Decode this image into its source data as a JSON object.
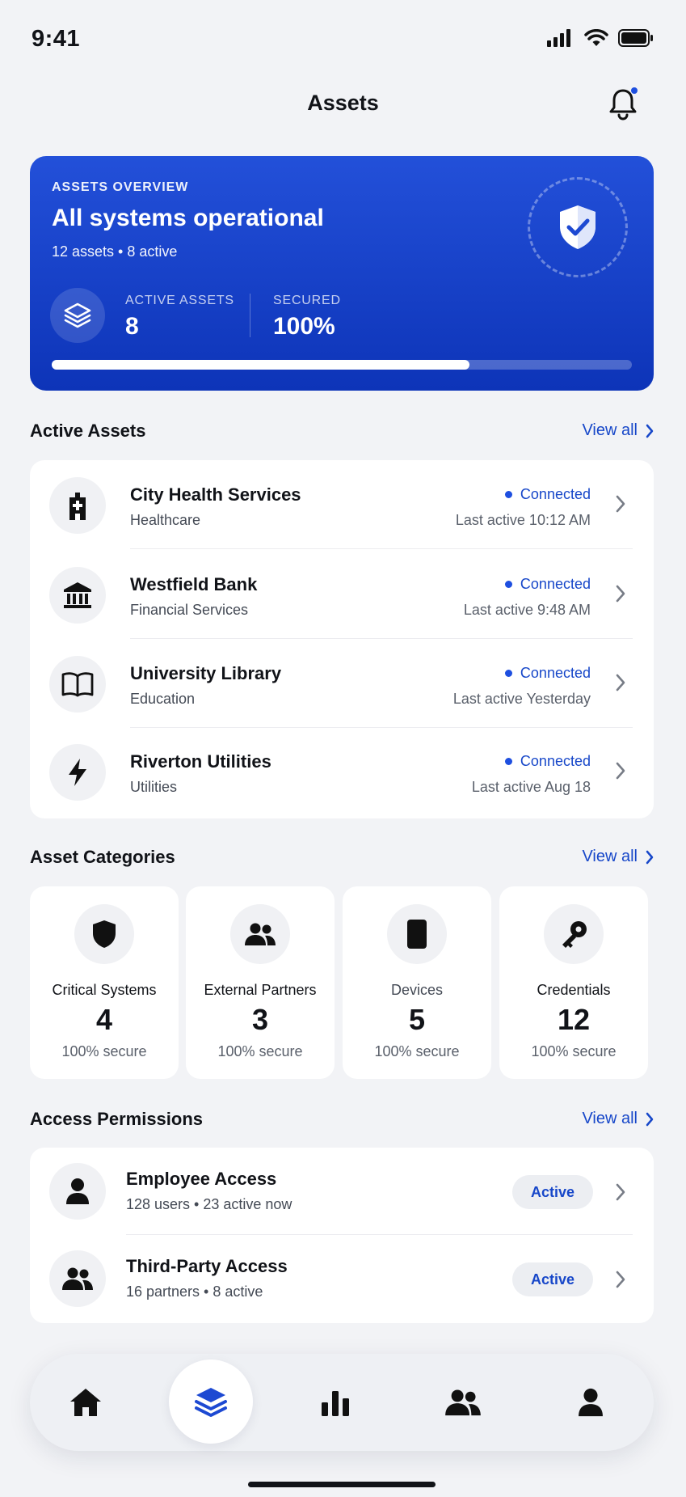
{
  "status_bar": {
    "time": "9:41"
  },
  "header": {
    "title": "Assets"
  },
  "overview": {
    "eyebrow": "ASSETS OVERVIEW",
    "title": "All systems operational",
    "subtitle": "12 assets  •  8 active",
    "stats": [
      {
        "label": "ACTIVE ASSETS",
        "value": "8"
      },
      {
        "label": "SECURED",
        "value": "100%"
      }
    ],
    "progress_fraction": 0.72
  },
  "active_assets": {
    "title": "Active Assets",
    "view_all": "View all",
    "items": [
      {
        "name": "City Health Services",
        "category": "Healthcare",
        "status": "Connected",
        "last_active": "Last active 10:12 AM",
        "icon": "hospital-icon"
      },
      {
        "name": "Westfield Bank",
        "category": "Financial Services",
        "status": "Connected",
        "last_active": "Last active 9:48 AM",
        "icon": "bank-icon"
      },
      {
        "name": "University Library",
        "category": "Education",
        "status": "Connected",
        "last_active": "Last active Yesterday",
        "icon": "book-icon"
      },
      {
        "name": "Riverton Utilities",
        "category": "Utilities",
        "status": "Connected",
        "last_active": "Last active Aug 18",
        "icon": "lightning-icon"
      }
    ]
  },
  "categories": {
    "title": "Asset Categories",
    "view_all": "View all",
    "items": [
      {
        "name": "Critical Systems",
        "count": "4",
        "secure": "100% secure",
        "icon": "shield-icon"
      },
      {
        "name": "External Partners",
        "count": "3",
        "secure": "100% secure",
        "icon": "people-icon"
      },
      {
        "name": "Devices",
        "count": "5",
        "secure": "100% secure",
        "icon": "phone-icon"
      },
      {
        "name": "Credentials",
        "count": "12",
        "secure": "100% secure",
        "icon": "key-icon"
      }
    ]
  },
  "permissions": {
    "title": "Access Permissions",
    "view_all": "View all",
    "items": [
      {
        "name": "Employee Access",
        "sub": "128 users  •  23 active now",
        "badge": "Active",
        "icon": "person-icon"
      },
      {
        "name": "Third-Party Access",
        "sub": "16 partners  •  8 active",
        "badge": "Active",
        "icon": "group-icon"
      }
    ]
  },
  "tabbar": {
    "tabs": [
      "home-icon",
      "layers-icon",
      "chart-icon",
      "group-icon",
      "profile-icon"
    ],
    "active": "layers-icon"
  },
  "colors": {
    "accent": "#1747c9",
    "hero_top": "#2350d9",
    "hero_bottom": "#0d34b8"
  }
}
